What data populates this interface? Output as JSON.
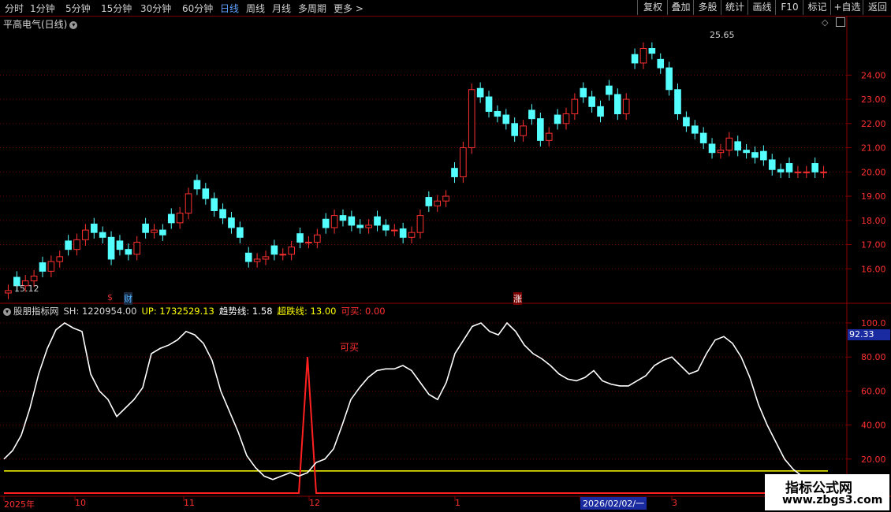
{
  "toolbar": {
    "periods": [
      "分时",
      "1分钟",
      "5分钟",
      "15分钟",
      "30分钟",
      "60分钟",
      "日线",
      "周线",
      "月线",
      "多周期",
      "更多 >"
    ],
    "active_period": "日线",
    "right_buttons": [
      "复权",
      "叠加",
      "多股",
      "统计",
      "画线",
      "F10",
      "标记",
      "+自选",
      "返回"
    ]
  },
  "stock": {
    "title": "平高电气(日线)",
    "menu_icon": "chevron-down-icon"
  },
  "price_chart": {
    "high_label": "25.65",
    "low_label": "15.12",
    "y_ticks": [
      "24.00",
      "23.00",
      "22.00",
      "21.00",
      "20.00",
      "19.00",
      "18.00",
      "17.00",
      "16.00"
    ],
    "markers": [
      {
        "label": "$",
        "color": "#e03030"
      },
      {
        "label": "财",
        "color": "#4fb0ff"
      },
      {
        "label": "涨",
        "color": "#ffffff"
      }
    ]
  },
  "indicator": {
    "name": "股朋指标网",
    "sh": "SH: 1220954.00",
    "up": "UP: 1732529.13",
    "trend": "趋势线: 1.58",
    "overfall": "超跌线: 13.00",
    "buy": "可买: 0.00",
    "buy_annotation": "可买",
    "current_value": "92.33",
    "y_ticks": [
      "100.0",
      "80.00",
      "60.00",
      "40.00",
      "20.00"
    ]
  },
  "x_axis": {
    "labels": [
      "2025年",
      "10",
      "11",
      "12",
      "1",
      "2",
      "3"
    ],
    "cursor_date": "2026/02/02/一"
  },
  "watermark": {
    "title": "指标公式网",
    "url": "www.zbgs3.com"
  },
  "colors": {
    "up": "#ff3030",
    "down": "#54ffff",
    "trend_line": "#ffffff",
    "overfall_line": "#ffff00",
    "buy_signal": "#ff2020"
  },
  "chart_data": {
    "type": "line",
    "title": "股朋指标网",
    "ylim": [
      0,
      100
    ],
    "series": [
      {
        "name": "趋势线",
        "values": [
          20,
          25,
          34,
          50,
          70,
          85,
          96,
          100,
          97,
          95,
          70,
          60,
          55,
          45,
          50,
          55,
          62,
          82,
          85,
          87,
          90,
          95,
          93,
          88,
          78,
          60,
          48,
          36,
          22,
          15,
          10,
          8,
          10,
          12,
          10,
          12,
          18,
          20,
          26,
          40,
          55,
          62,
          68,
          72,
          73,
          73,
          75,
          72,
          65,
          58,
          55,
          65,
          82,
          90,
          98,
          100,
          95,
          93,
          100,
          95,
          87,
          82,
          79,
          75,
          70,
          67,
          66,
          68,
          72,
          66,
          64,
          63,
          63,
          66,
          69,
          75,
          78,
          80,
          75,
          70,
          72,
          82,
          90,
          92,
          88,
          80,
          68,
          52,
          40,
          30,
          20,
          14,
          10,
          8,
          8,
          10
        ]
      },
      {
        "name": "超跌线",
        "values": [
          13,
          13,
          13,
          13,
          13,
          13,
          13,
          13,
          13,
          13,
          13,
          13,
          13,
          13,
          13,
          13,
          13,
          13,
          13,
          13,
          13,
          13,
          13,
          13,
          13,
          13,
          13,
          13,
          13,
          13,
          13,
          13,
          13,
          13,
          13,
          13,
          13,
          13,
          13,
          13,
          13,
          13,
          13,
          13,
          13,
          13,
          13,
          13,
          13,
          13,
          13,
          13,
          13,
          13,
          13,
          13,
          13,
          13,
          13,
          13,
          13,
          13,
          13,
          13,
          13,
          13,
          13,
          13,
          13,
          13,
          13,
          13,
          13,
          13,
          13,
          13,
          13,
          13,
          13,
          13,
          13,
          13,
          13,
          13,
          13,
          13,
          13,
          13,
          13,
          13,
          13,
          13,
          13,
          13,
          13,
          13
        ]
      },
      {
        "name": "可买",
        "values": [
          0,
          0,
          0,
          0,
          0,
          0,
          0,
          0,
          0,
          0,
          0,
          0,
          0,
          0,
          0,
          0,
          0,
          0,
          0,
          0,
          0,
          0,
          0,
          0,
          0,
          0,
          0,
          0,
          0,
          0,
          0,
          0,
          0,
          0,
          0,
          80,
          0,
          0,
          0,
          0,
          0,
          0,
          0,
          0,
          0,
          0,
          0,
          0,
          0,
          0,
          0,
          0,
          0,
          0,
          0,
          0,
          0,
          0,
          0,
          0,
          0,
          0,
          0,
          0,
          0,
          0,
          0,
          0,
          0,
          0,
          0,
          0,
          0,
          0,
          0,
          0,
          0,
          0,
          0,
          0,
          0,
          0,
          0,
          0,
          0,
          0,
          0,
          0,
          0,
          0,
          0,
          0,
          0,
          0,
          0,
          0
        ]
      }
    ],
    "candles_close": [
      15.1,
      15.3,
      15.5,
      15.7,
      15.9,
      16.3,
      16.5,
      16.8,
      17.2,
      17.6,
      17.5,
      17.3,
      16.4,
      16.8,
      16.6,
      17.1,
      17.5,
      17.6,
      17.4,
      17.9,
      18.3,
      19.1,
      19.3,
      18.9,
      18.4,
      18.1,
      17.7,
      17.3,
      16.3,
      16.4,
      16.5,
      16.6,
      16.6,
      16.9,
      17.1,
      17.1,
      17.4,
      17.7,
      18.2,
      18.0,
      17.8,
      17.7,
      17.8,
      17.8,
      17.6,
      17.6,
      17.3,
      17.5,
      18.2,
      18.6,
      18.8,
      19.0,
      19.8,
      21.0,
      23.4,
      23.1,
      22.5,
      22.3,
      22.0,
      21.5,
      21.9,
      22.2,
      21.3,
      21.6,
      22.0,
      22.4,
      23.0,
      23.1,
      22.7,
      22.3,
      23.2,
      22.4,
      23.0,
      24.5,
      25.1,
      24.9,
      24.3,
      23.4,
      22.4,
      21.9,
      21.6,
      21.2,
      20.8,
      20.9,
      21.4,
      20.9,
      20.8,
      20.6,
      20.5,
      20.1,
      20.0,
      20.0,
      20.0,
      20.0,
      20.0,
      20.0
    ],
    "price_ylim": [
      15,
      25.8
    ]
  }
}
